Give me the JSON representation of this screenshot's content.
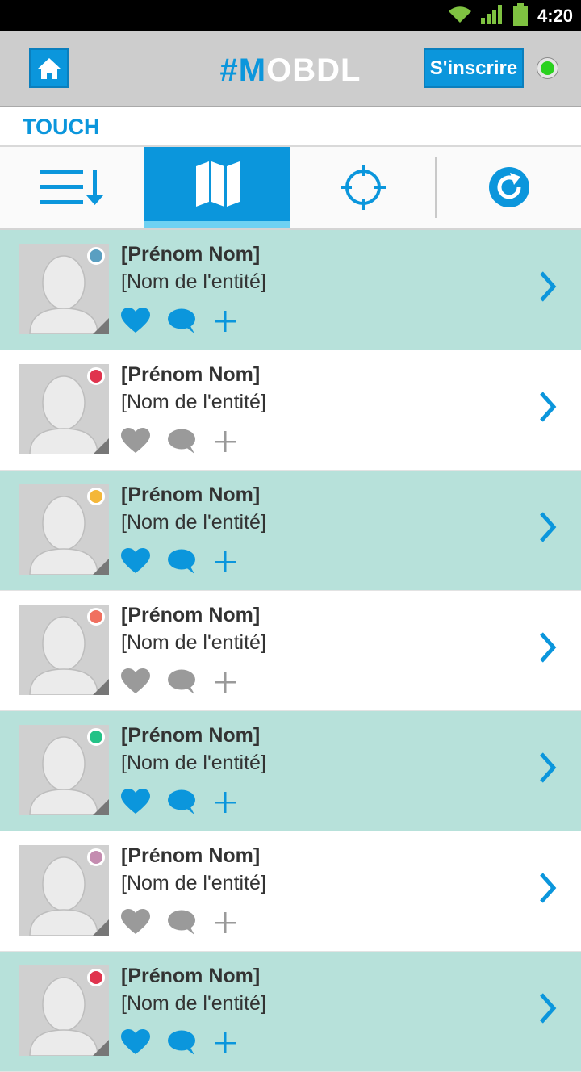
{
  "status_bar": {
    "time": "4:20",
    "icons": [
      "wifi-icon",
      "signal-icon",
      "battery-icon"
    ]
  },
  "header": {
    "home_icon": "home-icon",
    "logo_accent": "#M",
    "logo_rest": "OBDL",
    "signup_label": "S'inscrire",
    "status_color": "#2ad11f"
  },
  "section": {
    "title": "TOUCH"
  },
  "tabs": [
    {
      "icon": "sort-list-icon",
      "active": false
    },
    {
      "icon": "map-icon",
      "active": true
    },
    {
      "icon": "crosshair-icon",
      "active": false
    },
    {
      "icon": "refresh-icon",
      "active": false
    }
  ],
  "colors": {
    "accent": "#0b96dc",
    "highlight_row": "#b7e1da",
    "inactive_icon": "#9a9a9a"
  },
  "list": [
    {
      "name": "[Prénom Nom]",
      "entity": "[Nom de l'entité]",
      "dot": "#5a9fc1",
      "highlighted": true
    },
    {
      "name": "[Prénom Nom]",
      "entity": "[Nom de l'entité]",
      "dot": "#e0344e",
      "highlighted": false
    },
    {
      "name": "[Prénom Nom]",
      "entity": "[Nom de l'entité]",
      "dot": "#f4b739",
      "highlighted": true
    },
    {
      "name": "[Prénom Nom]",
      "entity": "[Nom de l'entité]",
      "dot": "#f07060",
      "highlighted": false
    },
    {
      "name": "[Prénom Nom]",
      "entity": "[Nom de l'entité]",
      "dot": "#24c287",
      "highlighted": true
    },
    {
      "name": "[Prénom Nom]",
      "entity": "[Nom de l'entité]",
      "dot": "#c48cb0",
      "highlighted": false
    },
    {
      "name": "[Prénom Nom]",
      "entity": "[Nom de l'entité]",
      "dot": "#e0344e",
      "highlighted": true
    }
  ]
}
